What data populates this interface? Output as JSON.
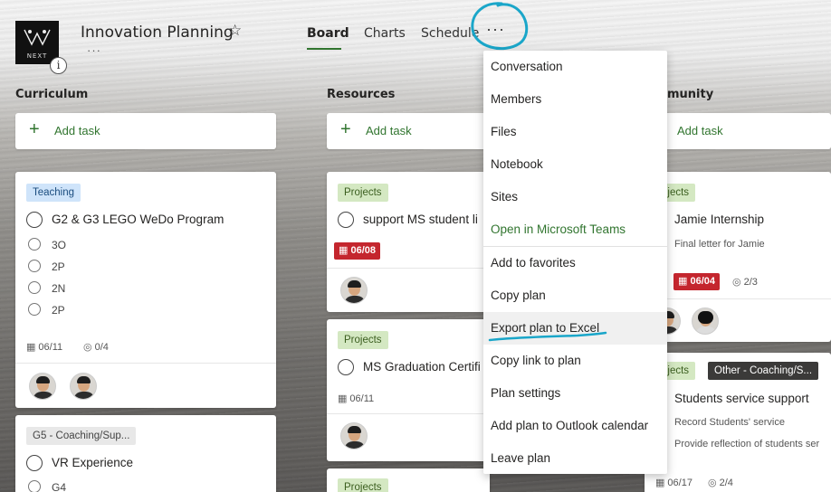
{
  "header": {
    "logo_text": "NEXT",
    "info_badge": "i",
    "plan_title": "Innovation Planning",
    "star": "☆",
    "title_more": "···",
    "tabs": [
      {
        "label": "Board",
        "active": true
      },
      {
        "label": "Charts",
        "active": false
      },
      {
        "label": "Schedule",
        "active": false
      }
    ],
    "more_tab": "···"
  },
  "accent_color": "#31752f",
  "buckets": [
    {
      "title": "Curriculum",
      "add_task": "Add task",
      "cards": [
        {
          "tag": "Teaching",
          "title": "G2 & G3 LEGO WeDo Program",
          "checklist": [
            "3O",
            "2P",
            "2N",
            "2P"
          ],
          "date": "06/11",
          "progress": "0/4"
        },
        {
          "tag": "G5 - Coaching/Sup...",
          "title": "VR Experience",
          "checklist": [
            "G4"
          ]
        }
      ]
    },
    {
      "title": "Resources",
      "add_task": "Add task",
      "cards": [
        {
          "tag": "Projects",
          "title": "support MS student li",
          "date": "06/08"
        },
        {
          "tag": "Projects",
          "title": "MS Graduation Certifi",
          "date": "06/11"
        },
        {
          "tag": "Projects"
        }
      ]
    },
    {
      "title": "munity",
      "add_task": "Add task",
      "cards": [
        {
          "tag": "ojects",
          "title": "Jamie Internship",
          "note": "Final letter for Jamie",
          "date": "06/04",
          "progress": "2/3"
        },
        {
          "tag": "ojects",
          "tag2": "Other - Coaching/S...",
          "title": "Students service support",
          "checklist": [
            "Record Students' service",
            "Provide reflection of students ser"
          ],
          "date": "06/17",
          "progress": "2/4"
        }
      ]
    }
  ],
  "menu": {
    "items": [
      "Conversation",
      "Members",
      "Files",
      "Notebook",
      "Sites",
      "Open in Microsoft Teams",
      "Add to favorites",
      "Copy plan",
      "Export plan to Excel",
      "Copy link to plan",
      "Plan settings",
      "Add plan to Outlook calendar",
      "Leave plan"
    ]
  },
  "icons": {
    "plus": "+",
    "calendar": "▦",
    "checklist": "◎"
  }
}
